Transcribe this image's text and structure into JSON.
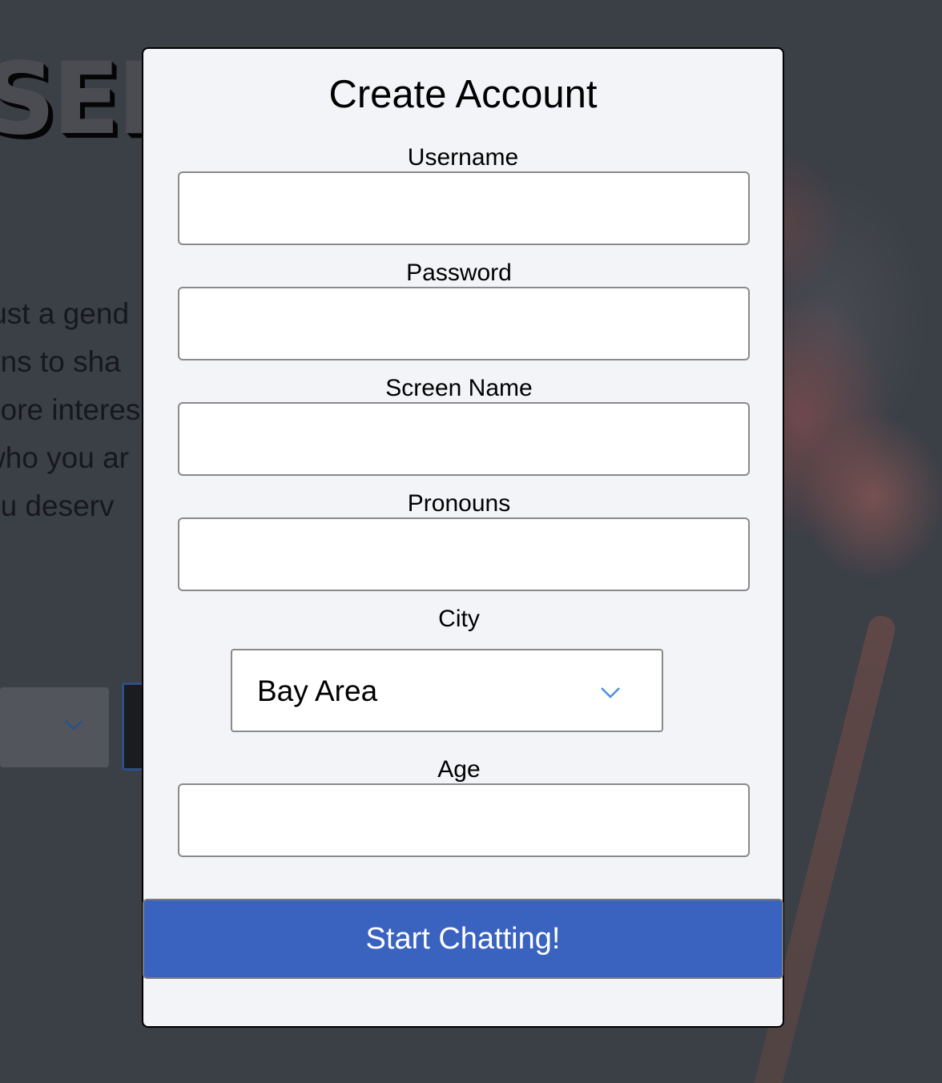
{
  "background": {
    "logo_text": "SER",
    "intro_lines": [
      "just a gend",
      "ons to sha",
      "nore interes",
      "who you ar",
      "ou deserv"
    ]
  },
  "modal": {
    "title": "Create Account",
    "fields": {
      "username": {
        "label": "Username",
        "value": ""
      },
      "password": {
        "label": "Password",
        "value": ""
      },
      "screen_name": {
        "label": "Screen Name",
        "value": ""
      },
      "pronouns": {
        "label": "Pronouns",
        "value": ""
      },
      "city": {
        "label": "City",
        "selected": "Bay Area",
        "icon": "chevron-down-icon"
      },
      "age": {
        "label": "Age",
        "value": ""
      }
    },
    "submit_label": "Start Chatting!"
  },
  "colors": {
    "accent": "#3a63c0",
    "modal_bg": "#f3f4f8",
    "overlay": "#3b3f46",
    "chevron": "#4a90e2"
  }
}
